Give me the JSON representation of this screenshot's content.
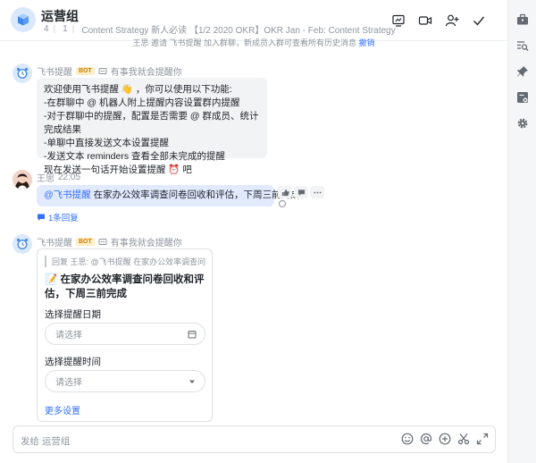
{
  "header": {
    "title": "运营组",
    "member_count": "4",
    "bot_count": "1",
    "meta_desc": "Content Strategy 新人必读 【1/2 2020 OKR】OKR Jan - Feb: Content Strategy #Lark 2020 ..."
  },
  "system_notice": {
    "text": "王思 邀请 飞书提醒 加入群聊，新成员入群可查看所有历史消息",
    "action": "撤销"
  },
  "messages": [
    {
      "sender": "飞书提醒",
      "badge": "BOT",
      "hint": "有事我就会提醒你",
      "lines": [
        "欢迎使用飞书提醒 👋 ，你可以使用以下功能:",
        "-在群聊中 @ 机器人附上提醒内容设置群内提醒",
        "-对于群聊中的提醒，配置是否需要 @ 群成员、统计完成结果",
        "-单聊中直接发送文本设置提醒",
        "-发送文本 reminders 查看全部未完成的提醒",
        "现在发送一句话开始设置提醒 ⏰ 吧"
      ]
    },
    {
      "sender": "王思",
      "time": "22:05",
      "mention": "@飞书提醒",
      "text": "在家办公效率调查问卷回收和评估，下周三前完成",
      "reply_count": "1条回复"
    },
    {
      "sender": "飞书提醒",
      "badge": "BOT",
      "hint": "有事我就会提醒你"
    }
  ],
  "card": {
    "quote": "回复 王思: @飞书提醒 在家办公效率调查问卷...",
    "title": "📝 在家办公效率调查问卷回收和评估，下周三前完成",
    "date_label": "选择提醒日期",
    "date_placeholder": "请选择",
    "time_label": "选择提醒时间",
    "time_placeholder": "请选择",
    "more": "更多设置"
  },
  "input": {
    "placeholder": "发给 运营组"
  },
  "colors": {
    "accent": "#3370ff",
    "bubble_gray": "#f2f3f5",
    "bubble_blue": "#e1eaff",
    "bot_badge_bg": "#fcefc7"
  }
}
